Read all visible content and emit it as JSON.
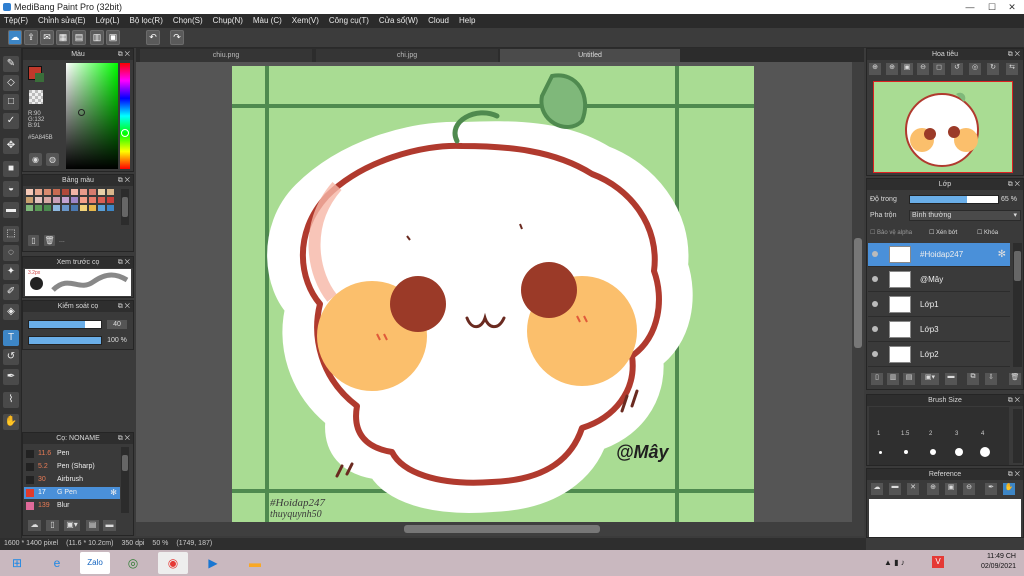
{
  "window": {
    "title": "MediBang Paint Pro (32bit)"
  },
  "menu": [
    "Tệp(F)",
    "Chỉnh sửa(E)",
    "Lớp(L)",
    "Bộ lọc(R)",
    "Chọn(S)",
    "Chụp(N)",
    "Màu (C)",
    "Xem(V)",
    "Công cụ(T)",
    "Cửa sổ(W)",
    "Cloud",
    "Help"
  ],
  "tabs": [
    "chiu.png",
    "chi.jpg",
    "Untitled"
  ],
  "color_panel": {
    "title": "Màu",
    "r": "R:90",
    "g": "G:132",
    "b": "B:91",
    "hex": "#5A845B",
    "main_color": "#c0392b"
  },
  "palette_panel": {
    "title": "Bảng màu",
    "more": "..."
  },
  "preview_panel": {
    "title": "Xem trước cọ",
    "size": "3.2px"
  },
  "brush_control": {
    "title": "Kiểm soát cọ",
    "size": "40",
    "opacity": "100 %",
    "size_fill": 0.78,
    "opacity_fill": 1.0
  },
  "brush_list": {
    "title": "Cọ: NONAME",
    "items": [
      {
        "num": "11.6",
        "name": "Pen"
      },
      {
        "num": "5.2",
        "name": "Pen (Sharp)"
      },
      {
        "num": "30",
        "name": "Airbrush"
      },
      {
        "num": "17",
        "name": "G Pen"
      },
      {
        "num": "139",
        "name": "Blur"
      }
    ]
  },
  "navigator": {
    "title": "Hoa tiêu"
  },
  "layer_panel": {
    "title": "Lớp",
    "opacity_label": "Độ trong",
    "opacity_value": "65 %",
    "opacity_fill": 0.65,
    "blend_label": "Pha trộn",
    "blend_value": "Bình thường",
    "protect_alpha": "Bảo vệ alpha",
    "clipping": "Xén bớt",
    "lock": "Khóa",
    "layers": [
      "#Hoidap247",
      "@Mây",
      "Lớp1",
      "Lớp3",
      "Lớp2"
    ]
  },
  "brush_size": {
    "title": "Brush Size",
    "sizes": [
      "1",
      "1.5",
      "2",
      "3",
      "4"
    ]
  },
  "reference": {
    "title": "Reference"
  },
  "canvas": {
    "watermark_tag": "#Hoidap247",
    "watermark_name": "thuyquynh50",
    "signature": "@Mây"
  },
  "status": {
    "size": "1600 * 1400 pixel",
    "cm": "(11.6 * 10.2cm)",
    "dpi": "350 dpi",
    "zoom": "50 %",
    "coords": "(1749, 187)"
  },
  "taskbar": {
    "time": "11:49 CH",
    "date": "02/09/2021",
    "lang": "V"
  },
  "colors": {
    "bg_green": "#a9dc93",
    "grid_green": "#4f8a4f",
    "outline": "#b03a2e",
    "blush": "#fbbf6c",
    "cheek": "#9b3a28",
    "accent": "#3d86c6"
  }
}
